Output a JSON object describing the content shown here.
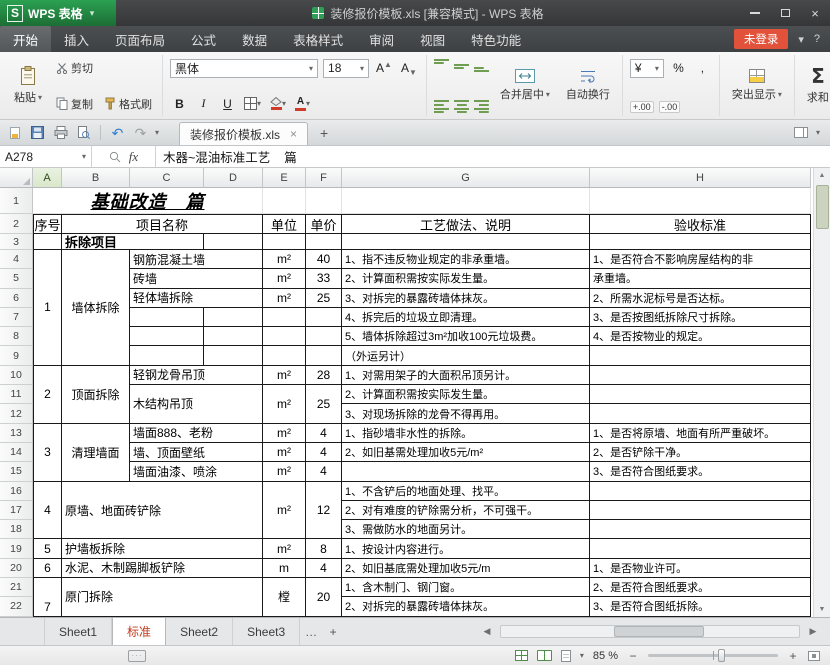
{
  "titlebar": {
    "logo_letter": "S",
    "app_name": "WPS 表格",
    "title": "装修报价模板.xls [兼容模式] - WPS 表格"
  },
  "menu": {
    "tabs": [
      "开始",
      "插入",
      "页面布局",
      "公式",
      "数据",
      "表格样式",
      "审阅",
      "视图",
      "特色功能"
    ],
    "active_tab": "开始",
    "login_label": "未登录"
  },
  "ribbon": {
    "paste": "粘贴",
    "cut": "剪切",
    "copy": "复制",
    "format_painter": "格式刷",
    "font_name": "黑体",
    "font_size": "18",
    "bold": "B",
    "italic": "I",
    "underline": "U",
    "grow_font": "A",
    "shrink_font": "A",
    "merge_center": "合并居中",
    "wrap_text": "自动换行",
    "highlight": "突出显示",
    "sum_label": "求和"
  },
  "quick": {
    "doc_tab": "装修报价模板.xls"
  },
  "formula": {
    "name_box": "A278",
    "fx": "fx",
    "content": "木器~混油标准工艺    篇"
  },
  "sheet": {
    "columns": [
      "A",
      "B",
      "C",
      "D",
      "E",
      "F",
      "G",
      "H"
    ],
    "active_column": "A",
    "rows": 22,
    "cells": [
      {
        "r": 1,
        "c": 1,
        "cs": 4,
        "t": "基础改造　篇",
        "s": "title"
      },
      {
        "r": 2,
        "c": 1,
        "t": "序号",
        "s": "h"
      },
      {
        "r": 2,
        "c": 2,
        "cs": 3,
        "t": "项目名称",
        "s": "h"
      },
      {
        "r": 2,
        "c": 5,
        "t": "单位",
        "s": "h"
      },
      {
        "r": 2,
        "c": 6,
        "t": "单价",
        "s": "h"
      },
      {
        "r": 2,
        "c": 7,
        "t": "工艺做法、说明",
        "s": "h"
      },
      {
        "r": 2,
        "c": 8,
        "t": "验收标准",
        "s": "h"
      },
      {
        "r": 3,
        "c": 2,
        "cs": 2,
        "t": "拆除项目",
        "s": "b"
      },
      {
        "r": 4,
        "c": 1,
        "rs": 6,
        "t": "1",
        "s": "c"
      },
      {
        "r": 4,
        "c": 2,
        "rs": 6,
        "t": "墙体拆除",
        "s": "c"
      },
      {
        "r": 4,
        "c": 3,
        "cs": 2,
        "t": "钢筋混凝土墙",
        "s": "l"
      },
      {
        "r": 4,
        "c": 5,
        "t": "m²",
        "s": "c"
      },
      {
        "r": 4,
        "c": 6,
        "t": "40",
        "s": "c"
      },
      {
        "r": 4,
        "c": 7,
        "t": "1、指不违反物业规定的非承重墙。",
        "s": "g"
      },
      {
        "r": 4,
        "c": 8,
        "t": "1、是否符合不影响房屋结构的非",
        "s": "g"
      },
      {
        "r": 5,
        "c": 3,
        "cs": 2,
        "t": "砖墙",
        "s": "l"
      },
      {
        "r": 5,
        "c": 5,
        "t": "m²",
        "s": "c"
      },
      {
        "r": 5,
        "c": 6,
        "t": "33",
        "s": "c"
      },
      {
        "r": 5,
        "c": 7,
        "t": "2、计算面积需按实际发生量。",
        "s": "g"
      },
      {
        "r": 5,
        "c": 8,
        "t": "承重墙。",
        "s": "g"
      },
      {
        "r": 6,
        "c": 3,
        "cs": 2,
        "t": "轻体墙拆除",
        "s": "l"
      },
      {
        "r": 6,
        "c": 5,
        "t": "m²",
        "s": "c"
      },
      {
        "r": 6,
        "c": 6,
        "t": "25",
        "s": "c"
      },
      {
        "r": 6,
        "c": 7,
        "t": "3、对拆完的暴露砖墙体抹灰。",
        "s": "g"
      },
      {
        "r": 6,
        "c": 8,
        "t": "2、所需水泥标号是否达标。",
        "s": "g"
      },
      {
        "r": 7,
        "c": 7,
        "t": "4、拆完后的垃圾立即清理。",
        "s": "g"
      },
      {
        "r": 7,
        "c": 8,
        "t": "3、是否按图纸拆除尺寸拆除。",
        "s": "g"
      },
      {
        "r": 8,
        "c": 7,
        "t": "5、墙体拆除超过3m²加收100元垃圾费。",
        "s": "g"
      },
      {
        "r": 8,
        "c": 8,
        "t": "4、是否按物业的规定。",
        "s": "g"
      },
      {
        "r": 9,
        "c": 7,
        "t": "（外运另计）",
        "s": "g"
      },
      {
        "r": 10,
        "c": 1,
        "rs": 3,
        "t": "2",
        "s": "c"
      },
      {
        "r": 10,
        "c": 2,
        "rs": 3,
        "t": "顶面拆除",
        "s": "c"
      },
      {
        "r": 10,
        "c": 3,
        "cs": 2,
        "t": "轻钢龙骨吊顶",
        "s": "l"
      },
      {
        "r": 10,
        "c": 5,
        "t": "m²",
        "s": "c"
      },
      {
        "r": 10,
        "c": 6,
        "t": "28",
        "s": "c"
      },
      {
        "r": 10,
        "c": 7,
        "t": "1、对需用架子的大面积吊顶另计。",
        "s": "g"
      },
      {
        "r": 11,
        "c": 3,
        "rs": 2,
        "cs": 2,
        "t": "木结构吊顶",
        "s": "l"
      },
      {
        "r": 11,
        "c": 5,
        "rs": 2,
        "t": "m²",
        "s": "c"
      },
      {
        "r": 11,
        "c": 6,
        "rs": 2,
        "t": "25",
        "s": "c"
      },
      {
        "r": 11,
        "c": 7,
        "t": "2、计算面积需按实际发生量。",
        "s": "g"
      },
      {
        "r": 12,
        "c": 7,
        "t": "3、对现场拆除的龙骨不得再用。",
        "s": "g"
      },
      {
        "r": 13,
        "c": 1,
        "rs": 3,
        "t": "3",
        "s": "c"
      },
      {
        "r": 13,
        "c": 2,
        "rs": 3,
        "t": "清理墙面",
        "s": "c"
      },
      {
        "r": 13,
        "c": 3,
        "cs": 2,
        "t": "墙面888、老粉",
        "s": "l"
      },
      {
        "r": 13,
        "c": 5,
        "t": "m²",
        "s": "c"
      },
      {
        "r": 13,
        "c": 6,
        "t": "4",
        "s": "c"
      },
      {
        "r": 13,
        "c": 7,
        "t": "1、指砂墙非水性的拆除。",
        "s": "g"
      },
      {
        "r": 13,
        "c": 8,
        "t": "1、是否将原墙、地面有所严重破坏。",
        "s": "g"
      },
      {
        "r": 14,
        "c": 3,
        "cs": 2,
        "t": "墙、顶面壁纸",
        "s": "l"
      },
      {
        "r": 14,
        "c": 5,
        "t": "m²",
        "s": "c"
      },
      {
        "r": 14,
        "c": 6,
        "t": "4",
        "s": "c"
      },
      {
        "r": 14,
        "c": 7,
        "t": "2、如旧基需处理加收5元/m²",
        "s": "g"
      },
      {
        "r": 14,
        "c": 8,
        "t": "2、是否铲除干净。",
        "s": "g"
      },
      {
        "r": 15,
        "c": 3,
        "cs": 2,
        "t": "墙面油漆、喷涂",
        "s": "l"
      },
      {
        "r": 15,
        "c": 5,
        "t": "m²",
        "s": "c"
      },
      {
        "r": 15,
        "c": 6,
        "t": "4",
        "s": "c"
      },
      {
        "r": 15,
        "c": 8,
        "t": "3、是否符合图纸要求。",
        "s": "g"
      },
      {
        "r": 16,
        "c": 1,
        "rs": 3,
        "t": "4",
        "s": "c"
      },
      {
        "r": 16,
        "c": 2,
        "rs": 3,
        "cs": 3,
        "t": "原墙、地面砖铲除",
        "s": "l"
      },
      {
        "r": 16,
        "c": 5,
        "rs": 3,
        "t": "m²",
        "s": "c"
      },
      {
        "r": 16,
        "c": 6,
        "rs": 3,
        "t": "12",
        "s": "c"
      },
      {
        "r": 16,
        "c": 7,
        "t": "1、不含铲后的地面处理、找平。",
        "s": "g"
      },
      {
        "r": 17,
        "c": 7,
        "t": "2、对有难度的铲除需分析，不可强干。",
        "s": "g"
      },
      {
        "r": 18,
        "c": 7,
        "t": "3、需做防水的地面另计。",
        "s": "g"
      },
      {
        "r": 19,
        "c": 1,
        "t": "5",
        "s": "c"
      },
      {
        "r": 19,
        "c": 2,
        "cs": 3,
        "t": "护墙板拆除",
        "s": "l"
      },
      {
        "r": 19,
        "c": 5,
        "t": "m²",
        "s": "c"
      },
      {
        "r": 19,
        "c": 6,
        "t": "8",
        "s": "c"
      },
      {
        "r": 19,
        "c": 7,
        "t": "1、按设计内容进行。",
        "s": "g"
      },
      {
        "r": 20,
        "c": 1,
        "t": "6",
        "s": "c"
      },
      {
        "r": 20,
        "c": 2,
        "cs": 3,
        "t": "水泥、木制踢脚板铲除",
        "s": "l"
      },
      {
        "r": 20,
        "c": 5,
        "t": "m",
        "s": "c"
      },
      {
        "r": 20,
        "c": 6,
        "t": "4",
        "s": "c"
      },
      {
        "r": 20,
        "c": 7,
        "t": "2、如旧基底需处理加收5元/m",
        "s": "g"
      },
      {
        "r": 20,
        "c": 8,
        "t": "1、是否物业许可。",
        "s": "g"
      },
      {
        "r": 21,
        "c": 1,
        "rs": 2,
        "t": "7",
        "s": "cb"
      },
      {
        "r": 21,
        "c": 2,
        "rs": 2,
        "cs": 3,
        "t": "原门拆除",
        "s": "l"
      },
      {
        "r": 21,
        "c": 5,
        "rs": 2,
        "t": "樘",
        "s": "c"
      },
      {
        "r": 21,
        "c": 6,
        "rs": 2,
        "t": "20",
        "s": "c"
      },
      {
        "r": 21,
        "c": 7,
        "t": "1、含木制门、钢门窗。",
        "s": "g"
      },
      {
        "r": 21,
        "c": 8,
        "t": "2、是否符合图纸要求。",
        "s": "g"
      },
      {
        "r": 22,
        "c": 7,
        "t": "2、对拆完的暴露砖墙体抹灰。",
        "s": "g"
      },
      {
        "r": 22,
        "c": 8,
        "t": "3、是否符合图纸拆除。",
        "s": "g"
      }
    ]
  },
  "sheet_tabs": {
    "tabs": [
      "Sheet1",
      "标准",
      "Sheet2",
      "Sheet3"
    ],
    "active": "标准",
    "overflow": "…",
    "add": "+"
  },
  "status": {
    "zoom": "85 %"
  },
  "glyphs": {
    "dropdown": "▾",
    "close": "×",
    "question": "?",
    "plus": "+",
    "undo": "↶",
    "redo": "↷",
    "up": "▲",
    "down": "▼",
    "left": "◀",
    "right": "▶",
    "ellipsis": "…",
    "percent": "%",
    "currency": "¥",
    "comma": ",",
    "dec_inc": "+.00",
    "dec_dec": "-.00",
    "sum_sigma": "Σ",
    "minus": "−",
    "kb_dots": "···"
  },
  "colors": {
    "wps_green": "#1f7a38",
    "login_red": "#e2523a",
    "active_sheet_text": "#c03a1d",
    "table_border": "#1a1a1a",
    "active_column_header": "#d9e7ca"
  }
}
